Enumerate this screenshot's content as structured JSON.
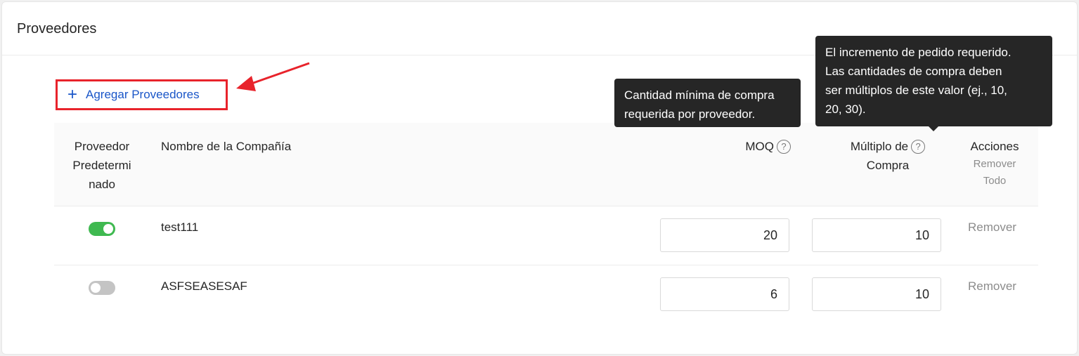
{
  "header": {
    "title": "Proveedores"
  },
  "add_button": {
    "icon": "plus-icon",
    "label": "Agregar Proveedores"
  },
  "table": {
    "columns": {
      "default": [
        "Proveedor",
        "Predetermi",
        "nado"
      ],
      "name": "Nombre de la Compañía",
      "moq": "MOQ",
      "multiple": [
        "Múltiplo de",
        "Compra"
      ],
      "actions": "Acciones",
      "remove_all": [
        "Remover",
        "Todo"
      ]
    },
    "rows": [
      {
        "default": true,
        "name": "test111",
        "moq": "20",
        "multiple": "10",
        "action": "Remover"
      },
      {
        "default": false,
        "name": "ASFSEASESAF",
        "moq": "6",
        "multiple": "10",
        "action": "Remover"
      }
    ]
  },
  "tooltips": {
    "moq": [
      "Cantidad mínima de compra",
      "requerida por proveedor."
    ],
    "multiple": [
      "El incremento de pedido requerido.",
      "Las cantidades de compra deben",
      "ser múltiplos de este valor (ej., 10,",
      "20, 30)."
    ]
  },
  "colors": {
    "accent": "#1a56c8",
    "highlight": "#e8232b",
    "toggle_on": "#3fb950"
  }
}
